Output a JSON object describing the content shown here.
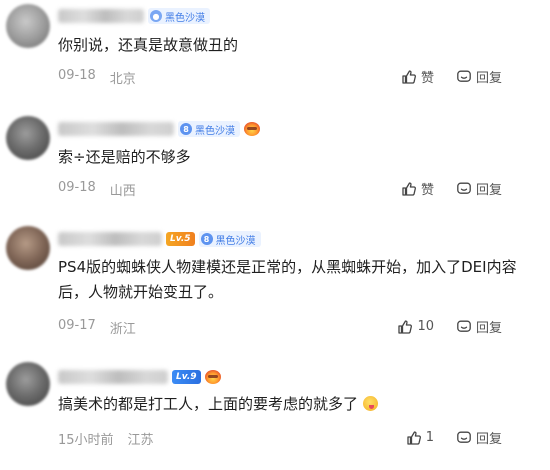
{
  "comments": [
    {
      "level": "",
      "tag": "黑色沙漠",
      "tag_badge": "",
      "text": "你别说，还真是故意做丑的",
      "date": "09-18",
      "location": "北京",
      "like_label": "赞",
      "reply_label": "回复"
    },
    {
      "level": "",
      "tag": "黑色沙漠",
      "tag_badge": "8",
      "text": "索÷还是赔的不够多",
      "date": "09-18",
      "location": "山西",
      "like_label": "赞",
      "reply_label": "回复"
    },
    {
      "level": "Lv.5",
      "tag": "黑色沙漠",
      "tag_badge": "8",
      "text": "PS4版的蜘蛛侠人物建模还是正常的，从黑蜘蛛开始，加入了DEI内容后，人物就开始变丑了。",
      "date": "09-17",
      "location": "浙江",
      "like_label": "10",
      "reply_label": "回复"
    },
    {
      "level": "Lv.9",
      "tag": "",
      "tag_badge": "",
      "text": "搞美术的都是打工人，上面的要考虑的就多了",
      "date": "15小时前",
      "location": "江苏",
      "like_label": "1",
      "reply_label": "回复"
    }
  ]
}
